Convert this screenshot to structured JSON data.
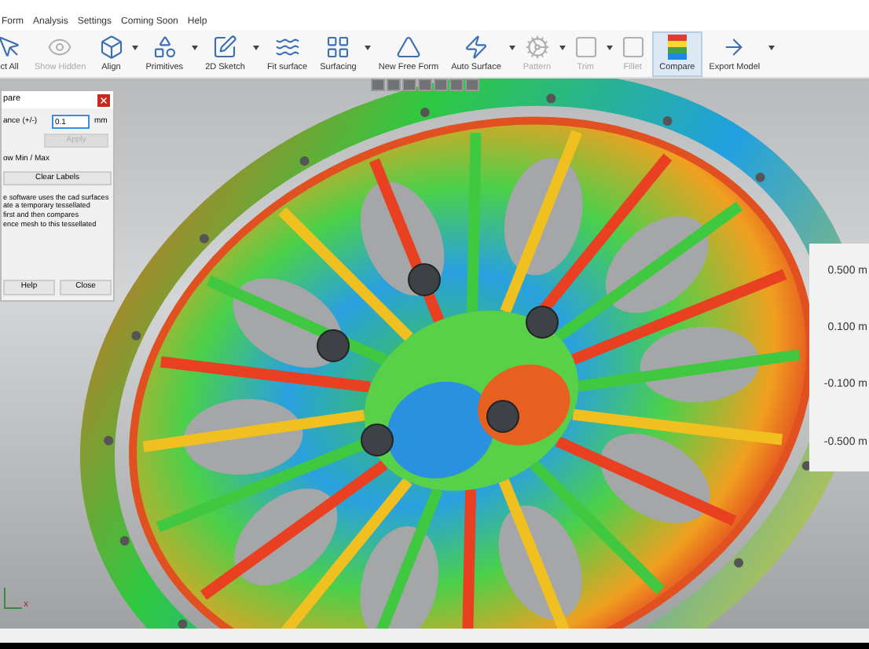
{
  "menu": [
    "Form",
    "Analysis",
    "Settings",
    "Coming Soon",
    "Help"
  ],
  "toolbar": [
    {
      "label": "ct All",
      "disabled": false,
      "selected": false,
      "dropdown": false
    },
    {
      "label": "Show Hidden",
      "disabled": true,
      "selected": false,
      "dropdown": false
    },
    {
      "label": "Align",
      "disabled": false,
      "selected": false,
      "dropdown": true
    },
    {
      "label": "Primitives",
      "disabled": false,
      "selected": false,
      "dropdown": true
    },
    {
      "label": "2D Sketch",
      "disabled": false,
      "selected": false,
      "dropdown": true
    },
    {
      "label": "Fit surface",
      "disabled": false,
      "selected": false,
      "dropdown": false
    },
    {
      "label": "Surfacing",
      "disabled": false,
      "selected": false,
      "dropdown": true
    },
    {
      "label": "New Free Form",
      "disabled": false,
      "selected": false,
      "dropdown": false
    },
    {
      "label": "Auto Surface",
      "disabled": false,
      "selected": false,
      "dropdown": true
    },
    {
      "label": "Pattern",
      "disabled": true,
      "selected": false,
      "dropdown": true
    },
    {
      "label": "Trim",
      "disabled": true,
      "selected": false,
      "dropdown": true
    },
    {
      "label": "Fillet",
      "disabled": true,
      "selected": false,
      "dropdown": false
    },
    {
      "label": "Compare",
      "disabled": false,
      "selected": true,
      "dropdown": false
    },
    {
      "label": "Export Model",
      "disabled": false,
      "selected": false,
      "dropdown": true
    }
  ],
  "dialog": {
    "title": "pare",
    "tolerance_label": "ance (+/-)",
    "tolerance_value": "0.1",
    "unit": "mm",
    "apply": {
      "label": "Apply",
      "disabled": true
    },
    "show_min_max": "ow Min / Max",
    "clear_labels": "Clear Labels",
    "description": "e software uses the cad surfaces\nate a temporary tessellated\n first and then compares\nence mesh to this tessellated",
    "help": "Help",
    "close": "Close"
  },
  "legend": [
    "0.500 m",
    "0.100 m",
    "-0.100 m",
    "-0.500 m"
  ],
  "axis_label": "x"
}
